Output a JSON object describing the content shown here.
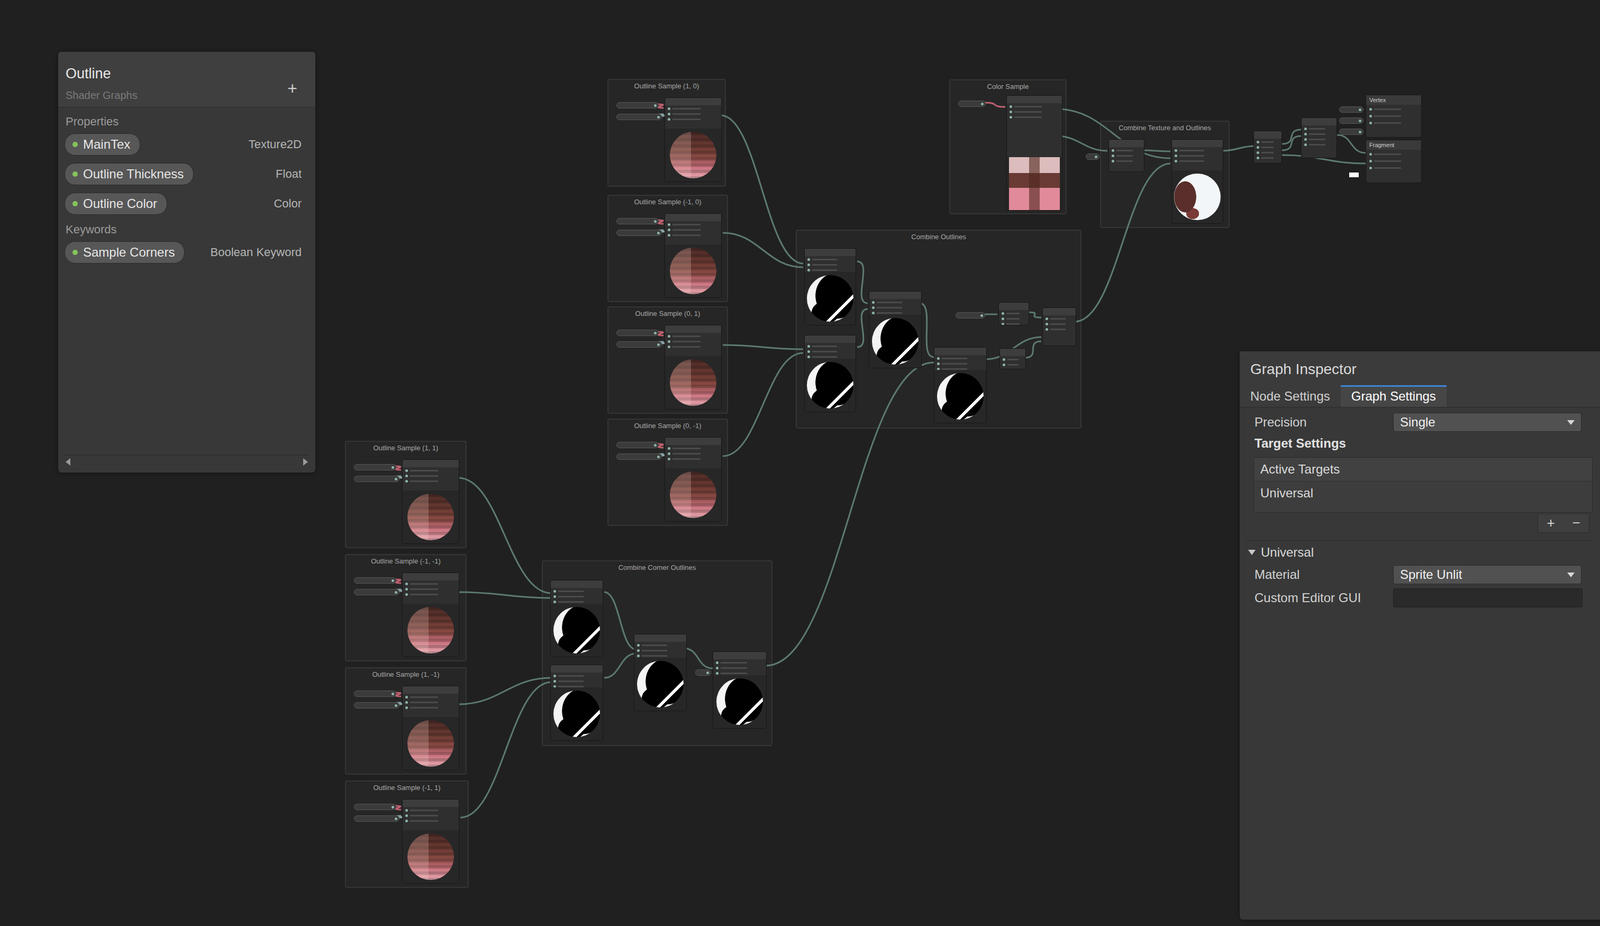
{
  "blackboard": {
    "title": "Outline",
    "subtitle": "Shader Graphs",
    "add_button": "+",
    "sections": [
      {
        "label": "Properties",
        "items": [
          {
            "name": "MainTex",
            "type": "Texture2D"
          },
          {
            "name": "Outline Thickness",
            "type": "Float"
          },
          {
            "name": "Outline Color",
            "type": "Color"
          }
        ]
      },
      {
        "label": "Keywords",
        "items": [
          {
            "name": "Sample Corners",
            "type": "Boolean Keyword"
          }
        ]
      }
    ]
  },
  "groups": [
    {
      "title": "Outline Sample (1, 0)",
      "kind": "sample"
    },
    {
      "title": "Outline Sample (-1, 0)",
      "kind": "sample"
    },
    {
      "title": "Outline Sample (0, 1)",
      "kind": "sample"
    },
    {
      "title": "Outline Sample (0, -1)",
      "kind": "sample"
    },
    {
      "title": "Color Sample",
      "kind": "color"
    },
    {
      "title": "Combine Texture and Outlines",
      "kind": "texture"
    },
    {
      "title": "Combine Outlines",
      "kind": "outlines"
    },
    {
      "title": "Outline Sample (1, 1)",
      "kind": "sample"
    },
    {
      "title": "Outline Sample (-1, -1)",
      "kind": "sample"
    },
    {
      "title": "Outline Sample (1, -1)",
      "kind": "sample"
    },
    {
      "title": "Outline Sample (-1, 1)",
      "kind": "sample"
    },
    {
      "title": "Combine Corner Outlines",
      "kind": "corners"
    }
  ],
  "master_stack": [
    {
      "title": "Vertex"
    },
    {
      "title": "Fragment"
    }
  ],
  "inspector": {
    "title": "Graph Inspector",
    "tabs": [
      {
        "label": "Node Settings",
        "selected": false
      },
      {
        "label": "Graph Settings",
        "selected": true
      }
    ],
    "precision": {
      "label": "Precision",
      "value": "Single"
    },
    "target_settings": "Target Settings",
    "active_targets": {
      "header": "Active Targets",
      "items": [
        "Universal"
      ],
      "add": "+",
      "remove": "−"
    },
    "foldout": {
      "label": "Universal",
      "expanded": true
    },
    "material": {
      "label": "Material",
      "value": "Sprite Unlit"
    },
    "custom_editor": {
      "label": "Custom Editor GUI"
    }
  }
}
